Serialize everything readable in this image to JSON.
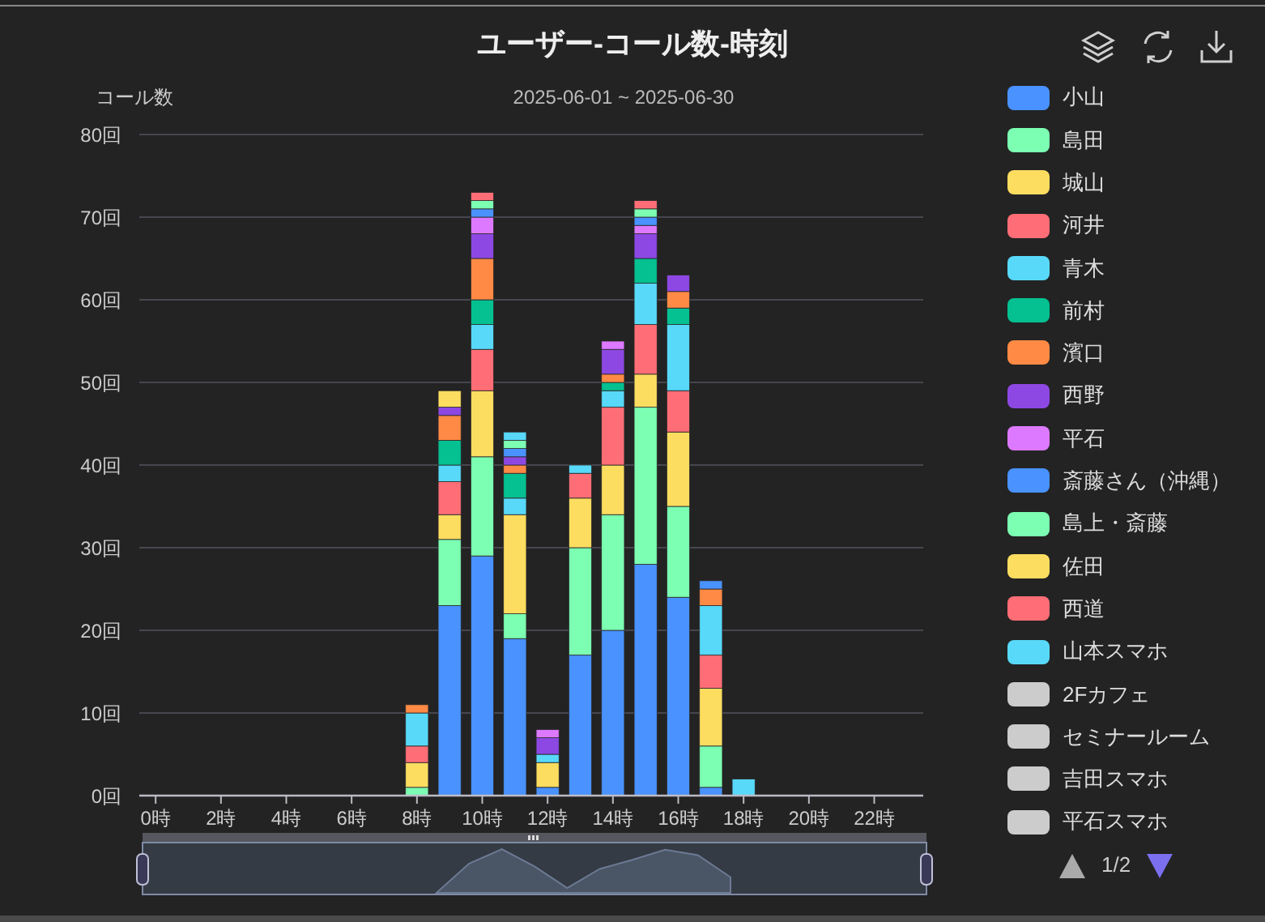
{
  "chart": {
    "title": "ユーザー-コール数-時刻",
    "subtitle": "2025-06-01 ~ 2025-06-30",
    "toolbar": [
      {
        "kind": "layers"
      },
      {
        "kind": "refresh"
      },
      {
        "kind": "download"
      }
    ],
    "chart_data": {
      "type": "bar",
      "stacked": true,
      "grid": true,
      "ylabel": "コール数",
      "x": [
        0,
        1,
        2,
        3,
        4,
        5,
        6,
        7,
        8,
        9,
        10,
        11,
        12,
        13,
        14,
        15,
        16,
        17,
        18,
        19,
        20,
        21,
        22,
        23
      ],
      "xlim": [
        -0.5,
        23.5
      ],
      "ylim": [
        0,
        80
      ],
      "xticks": [
        {
          "value": 0,
          "label": "0時"
        },
        {
          "value": 2,
          "label": "2時"
        },
        {
          "value": 4,
          "label": "4時"
        },
        {
          "value": 6,
          "label": "6時"
        },
        {
          "value": 8,
          "label": "8時"
        },
        {
          "value": 10,
          "label": "10時"
        },
        {
          "value": 12,
          "label": "12時"
        },
        {
          "value": 14,
          "label": "14時"
        },
        {
          "value": 16,
          "label": "16時"
        },
        {
          "value": 18,
          "label": "18時"
        },
        {
          "value": 20,
          "label": "20時"
        },
        {
          "value": 22,
          "label": "22時"
        }
      ],
      "yticks": [
        {
          "value": 0,
          "label": "0回"
        },
        {
          "value": 10,
          "label": "10回"
        },
        {
          "value": 20,
          "label": "20回"
        },
        {
          "value": 30,
          "label": "30回"
        },
        {
          "value": 40,
          "label": "40回"
        },
        {
          "value": 50,
          "label": "50回"
        },
        {
          "value": 60,
          "label": "60回"
        },
        {
          "value": 70,
          "label": "70回"
        },
        {
          "value": 80,
          "label": "80回"
        }
      ],
      "series": [
        {
          "name": "小山",
          "color": "#4992ff",
          "values": [
            0,
            0,
            0,
            0,
            0,
            0,
            0,
            0,
            0,
            23,
            29,
            19,
            1,
            17,
            20,
            28,
            24,
            1,
            0,
            0,
            0,
            0,
            0,
            0
          ]
        },
        {
          "name": "島田",
          "color": "#7cffb2",
          "values": [
            0,
            0,
            0,
            0,
            0,
            0,
            0,
            0,
            1,
            8,
            12,
            3,
            0,
            13,
            14,
            19,
            11,
            5,
            0,
            0,
            0,
            0,
            0,
            0
          ]
        },
        {
          "name": "城山",
          "color": "#fddd60",
          "values": [
            0,
            0,
            0,
            0,
            0,
            0,
            0,
            0,
            3,
            3,
            8,
            12,
            3,
            6,
            6,
            4,
            9,
            7,
            0,
            0,
            0,
            0,
            0,
            0
          ]
        },
        {
          "name": "河井",
          "color": "#ff6e76",
          "values": [
            0,
            0,
            0,
            0,
            0,
            0,
            0,
            0,
            2,
            4,
            5,
            0,
            0,
            3,
            7,
            6,
            5,
            4,
            0,
            0,
            0,
            0,
            0,
            0
          ]
        },
        {
          "name": "青木",
          "color": "#58d9f9",
          "values": [
            0,
            0,
            0,
            0,
            0,
            0,
            0,
            0,
            4,
            2,
            3,
            2,
            1,
            1,
            2,
            5,
            8,
            6,
            2,
            0,
            0,
            0,
            0,
            0
          ]
        },
        {
          "name": "前村",
          "color": "#05c091",
          "values": [
            0,
            0,
            0,
            0,
            0,
            0,
            0,
            0,
            0,
            3,
            3,
            3,
            0,
            0,
            1,
            3,
            2,
            0,
            0,
            0,
            0,
            0,
            0,
            0
          ]
        },
        {
          "name": "濱口",
          "color": "#ff8a45",
          "values": [
            0,
            0,
            0,
            0,
            0,
            0,
            0,
            0,
            1,
            3,
            5,
            1,
            0,
            0,
            1,
            0,
            2,
            2,
            0,
            0,
            0,
            0,
            0,
            0
          ]
        },
        {
          "name": "西野",
          "color": "#8d48e3",
          "values": [
            0,
            0,
            0,
            0,
            0,
            0,
            0,
            0,
            0,
            1,
            3,
            1,
            2,
            0,
            3,
            3,
            2,
            0,
            0,
            0,
            0,
            0,
            0,
            0
          ]
        },
        {
          "name": "平石",
          "color": "#dd79ff",
          "values": [
            0,
            0,
            0,
            0,
            0,
            0,
            0,
            0,
            0,
            0,
            2,
            0,
            1,
            0,
            1,
            1,
            0,
            0,
            0,
            0,
            0,
            0,
            0,
            0
          ]
        },
        {
          "name": "斎藤さん（沖縄）",
          "color": "#4992ff",
          "values": [
            0,
            0,
            0,
            0,
            0,
            0,
            0,
            0,
            0,
            0,
            1,
            1,
            0,
            0,
            0,
            1,
            0,
            1,
            0,
            0,
            0,
            0,
            0,
            0
          ]
        },
        {
          "name": "島上・斎藤",
          "color": "#7cffb2",
          "values": [
            0,
            0,
            0,
            0,
            0,
            0,
            0,
            0,
            0,
            0,
            1,
            1,
            0,
            0,
            0,
            1,
            0,
            0,
            0,
            0,
            0,
            0,
            0,
            0
          ]
        },
        {
          "name": "佐田",
          "color": "#fddd60",
          "values": [
            0,
            0,
            0,
            0,
            0,
            0,
            0,
            0,
            0,
            2,
            0,
            0,
            0,
            0,
            0,
            0,
            0,
            0,
            0,
            0,
            0,
            0,
            0,
            0
          ]
        },
        {
          "name": "西道",
          "color": "#ff6e76",
          "values": [
            0,
            0,
            0,
            0,
            0,
            0,
            0,
            0,
            0,
            0,
            1,
            0,
            0,
            0,
            0,
            1,
            0,
            0,
            0,
            0,
            0,
            0,
            0,
            0
          ]
        },
        {
          "name": "山本スマホ",
          "color": "#58d9f9",
          "values": [
            0,
            0,
            0,
            0,
            0,
            0,
            0,
            0,
            0,
            0,
            0,
            1,
            0,
            0,
            0,
            0,
            0,
            0,
            0,
            0,
            0,
            0,
            0,
            0
          ]
        }
      ]
    },
    "legend_hidden": [
      {
        "label": "2Fカフェ",
        "shown": false
      },
      {
        "label": "セミナールーム",
        "shown": false
      },
      {
        "label": "吉田スマホ",
        "shown": false
      },
      {
        "label": "平石スマホ",
        "shown": false
      }
    ],
    "pager": {
      "text": "1/2",
      "prev_disabled": true,
      "next_disabled": false
    }
  }
}
